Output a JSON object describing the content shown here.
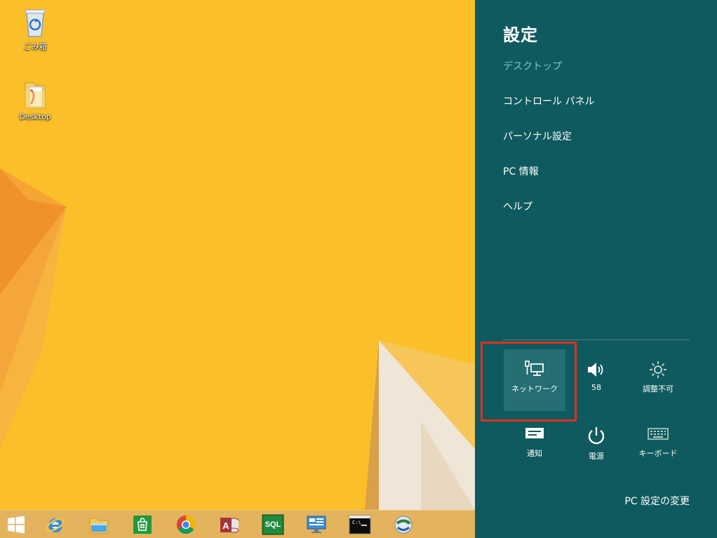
{
  "desktop": {
    "icons": [
      {
        "label": "ごみ箱",
        "icon": "recycle-bin-icon"
      },
      {
        "label": "Desktop",
        "icon": "folder-icon"
      }
    ]
  },
  "taskbar": {
    "items": [
      {
        "name": "start",
        "icon": "windows-logo-icon"
      },
      {
        "name": "internet-explorer",
        "icon": "ie-icon"
      },
      {
        "name": "file-explorer",
        "icon": "folder-icon"
      },
      {
        "name": "store",
        "icon": "store-icon"
      },
      {
        "name": "chrome",
        "icon": "chrome-icon"
      },
      {
        "name": "access",
        "icon": "access-icon"
      },
      {
        "name": "sql",
        "icon": "sql-icon",
        "text": "SQL"
      },
      {
        "name": "remote-desktop",
        "icon": "remote-desktop-icon"
      },
      {
        "name": "command-prompt",
        "icon": "cmd-icon",
        "text": "C:\\"
      },
      {
        "name": "network-app",
        "icon": "globe-arrow-icon"
      }
    ]
  },
  "charm": {
    "title": "設定",
    "subtitle": "デスクトップ",
    "menu": [
      {
        "label": "コントロール パネル"
      },
      {
        "label": "パーソナル設定"
      },
      {
        "label": "PC 情報"
      },
      {
        "label": "ヘルプ"
      }
    ],
    "quick_settings": [
      {
        "label": "ネットワーク",
        "icon": "network-icon",
        "active": true
      },
      {
        "label": "58",
        "icon": "speaker-icon",
        "active": false
      },
      {
        "label": "調整不可",
        "icon": "brightness-icon",
        "active": false
      },
      {
        "label": "通知",
        "icon": "notifications-icon",
        "active": false
      },
      {
        "label": "電源",
        "icon": "power-icon",
        "active": false
      },
      {
        "label": "キーボード",
        "icon": "keyboard-icon",
        "active": false
      }
    ],
    "change_settings": "PC 設定の変更"
  },
  "colors": {
    "wallpaper": "#fbbf2a",
    "charm_bg": "#0f5a5e",
    "charm_subtitle": "#6ccfc9",
    "tile_active": "#256e72",
    "highlight": "#e0301e"
  }
}
